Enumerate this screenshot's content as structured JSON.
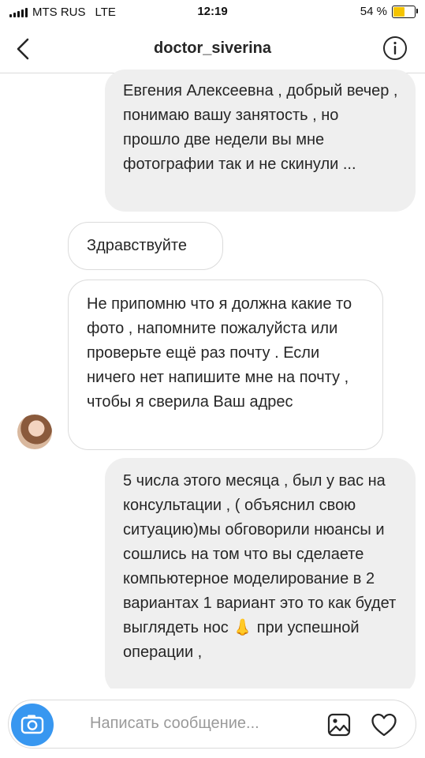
{
  "status_bar": {
    "carrier": "MTS RUS",
    "network": "LTE",
    "time": "12:19",
    "battery": "54 %",
    "battery_level": 0.54
  },
  "header": {
    "title": "doctor_siverina"
  },
  "messages": [
    {
      "direction": "out",
      "text": "Евгения Алексеевна , добрый вечер , понимаю вашу занятость , но прошло две недели вы мне фотографии так и не скинули ..."
    },
    {
      "direction": "in",
      "text": "Здравствуйте"
    },
    {
      "direction": "in",
      "text": "Не припомню что я должна какие то фото , напомните пожалуйста или проверьте ещё раз почту . Если ничего нет напишите мне на почту , чтобы я сверила Ваш адрес"
    },
    {
      "direction": "out",
      "text": "5 числа этого месяца , был у вас на консультации , ( объяснил свою ситуацию)мы обговорили нюансы и сошлись на том что вы сделаете компьютерное моделирование в 2 вариантах 1 вариант это то как будет выглядеть нос 👃 при успешной операции ,"
    }
  ],
  "composer": {
    "placeholder": "Написать сообщение..."
  },
  "icons": {
    "back": "chevron-left-icon",
    "info": "info-icon",
    "camera": "camera-icon",
    "gallery": "gallery-icon",
    "like": "heart-icon"
  },
  "colors": {
    "camera_blue": "#3897f0",
    "battery_yellow": "#f5c400",
    "bubble_out": "#efefef"
  }
}
